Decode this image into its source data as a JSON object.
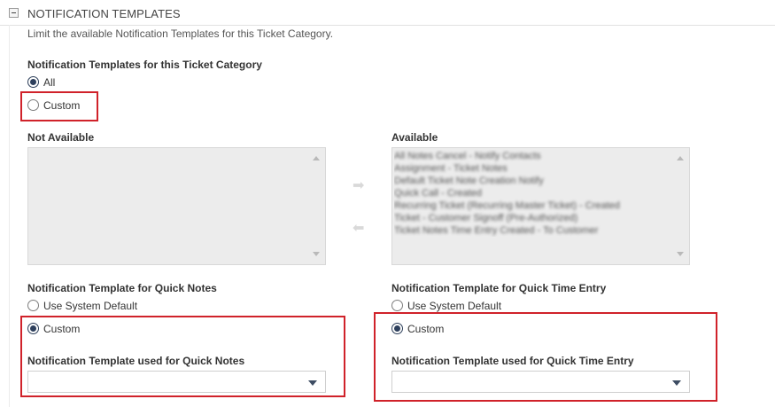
{
  "section": {
    "title": "NOTIFICATION TEMPLATES",
    "description": "Limit the available Notification Templates for this Ticket Category."
  },
  "category_templates": {
    "label": "Notification Templates for this Ticket Category",
    "options": [
      "All",
      "Custom"
    ],
    "selected": "All"
  },
  "not_available": {
    "label": "Not Available",
    "items": []
  },
  "available": {
    "label": "Available",
    "items": [
      "All Notes Cancel - Notify Contacts",
      "Assignment - Ticket Notes",
      "Default Ticket Note Creation Notify",
      "Quick Call - Created",
      "Recurring Ticket (Recurring Master Ticket) - Created",
      "Ticket - Customer Signoff (Pre-Authorized)",
      "Ticket Notes Time Entry Created - To Customer"
    ]
  },
  "quick_notes": {
    "label": "Notification Template for Quick Notes",
    "options": [
      "Use System Default",
      "Custom"
    ],
    "selected": "Custom",
    "select_label": "Notification Template used for Quick Notes",
    "select_value": ""
  },
  "quick_time_entry": {
    "label": "Notification Template for Quick Time Entry",
    "options": [
      "Use System Default",
      "Custom"
    ],
    "selected": "Custom",
    "select_label": "Notification Template used for Quick Time Entry",
    "select_value": ""
  },
  "colors": {
    "highlight": "#d0222a",
    "radio_checked": "#2d3f5c",
    "listbox_bg": "#ececec"
  }
}
